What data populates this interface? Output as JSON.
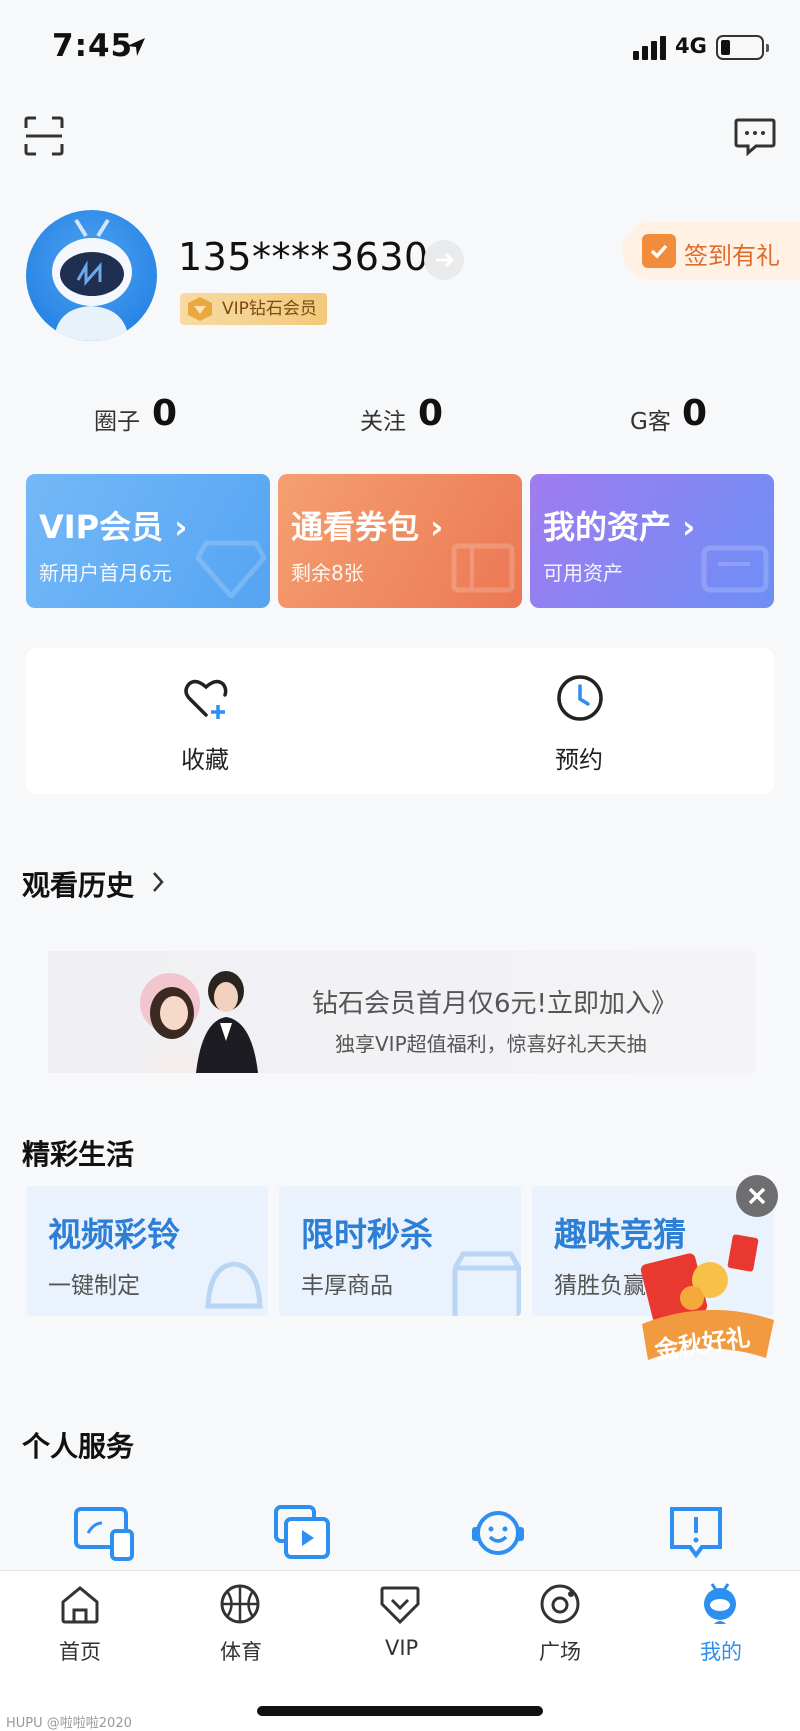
{
  "status_bar": {
    "time": "7:45",
    "network": "4G"
  },
  "profile": {
    "phone": "135****3630",
    "vip_badge": "VIP钻石会员",
    "signin_label": "签到有礼"
  },
  "stats": [
    {
      "label": "圈子",
      "value": "0"
    },
    {
      "label": "关注",
      "value": "0"
    },
    {
      "label": "G客",
      "value": "0"
    }
  ],
  "promo_cards": [
    {
      "title": "VIP会员 ›",
      "subtitle": "新用户首月6元",
      "color_start": "#6bb4f7",
      "color_end": "#57a8f4"
    },
    {
      "title": "通看券包 ›",
      "subtitle": "剩余8张",
      "color_start": "#f2946a",
      "color_end": "#ee7a55"
    },
    {
      "title": "我的资产 ›",
      "subtitle": "可用资产",
      "color_start": "#9a7df2",
      "color_end": "#6e8cf5"
    }
  ],
  "quick_actions": [
    {
      "label": "收藏",
      "icon": "heart-plus-icon"
    },
    {
      "label": "预约",
      "icon": "clock-icon"
    }
  ],
  "history": {
    "title": "观看历史"
  },
  "banner": {
    "main_text": "钻石会员首月仅6元!立即加入》",
    "sub_text": "独享VIP超值福利，惊喜好礼天天抽"
  },
  "life": {
    "title": "精彩生活",
    "cards": [
      {
        "title": "视频彩铃",
        "subtitle": "一键制定"
      },
      {
        "title": "限时秒杀",
        "subtitle": "丰厚商品"
      },
      {
        "title": "趣味竞猜",
        "subtitle": "猜胜负赢奖"
      }
    ],
    "gift_text": "金秋好礼"
  },
  "services": {
    "title": "个人服务",
    "icons": [
      "device-screen-icon",
      "video-stack-icon",
      "customer-service-icon",
      "feedback-icon"
    ]
  },
  "tabs": [
    {
      "label": "首页",
      "icon": "home-icon",
      "active": false
    },
    {
      "label": "体育",
      "icon": "basketball-icon",
      "active": false
    },
    {
      "label": "VIP",
      "icon": "vip-icon",
      "active": false
    },
    {
      "label": "广场",
      "icon": "plaza-icon",
      "active": false
    },
    {
      "label": "我的",
      "icon": "profile-mascot-icon",
      "active": true
    }
  ],
  "colors": {
    "accent": "#2d8ff0",
    "active_tab": "#2d8ff0",
    "signin": "#e06b2c"
  },
  "watermark": "HUPU @啦啦啦2020"
}
